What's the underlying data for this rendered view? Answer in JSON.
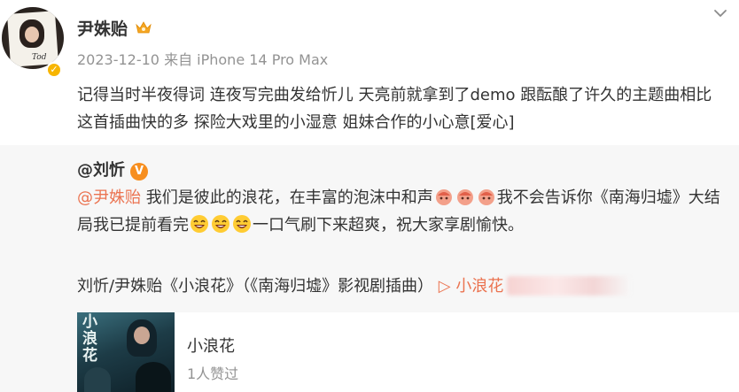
{
  "post": {
    "author": "尹姝贻",
    "meta": "2023-12-10 来自 iPhone 14 Pro Max",
    "text": "记得当时半夜得词 连夜写完曲发给忻儿 天亮前就拿到了demo 跟酝酿了许久的主题曲相比 这首插曲快的多 探险大戏里的小湿意 姐妹合作的小心意[爱心]"
  },
  "repost": {
    "author": "@刘忻",
    "mention": "@尹姝贻",
    "text_part1": " 我们是彼此的浪花，在丰富的泡沫中和声",
    "text_part2": "我不会告诉你《南海归墟》大结局我已提前看完",
    "text_part3": "一口气刷下来超爽，祝大家享剧愉快。",
    "song_line": "刘忻/尹姝贻《小浪花》（《南海归墟》影视剧插曲）",
    "song_link": "▷ 小浪花",
    "card": {
      "cover_title": "小浪花",
      "title": "小浪花",
      "likes": "1人赞过"
    }
  },
  "colors": {
    "accent": "#eb7350",
    "verify_gold": "#f7b500",
    "verify_orange": "#f78e1e",
    "repost_bg": "#f7f7f7",
    "meta_gray": "#939393"
  }
}
